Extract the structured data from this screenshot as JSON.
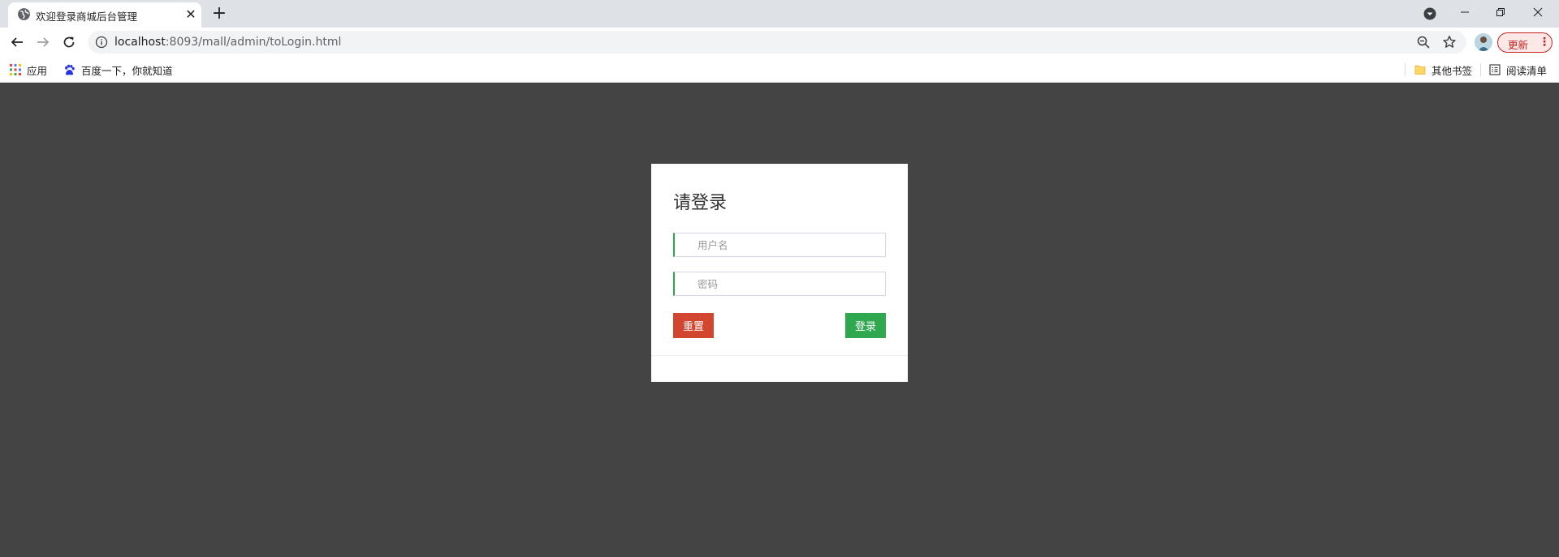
{
  "browser": {
    "tab": {
      "title": "欢迎登录商城后台管理",
      "close_glyph": "✕"
    },
    "new_tab_glyph": "+",
    "url_host": "localhost",
    "url_path": ":8093/mall/admin/toLogin.html",
    "update_label": "更新",
    "update_dots": "⋮",
    "bookmarks": {
      "apps": "应用",
      "baidu": "百度一下，你就知道",
      "other": "其他书签",
      "reading": "阅读清单"
    }
  },
  "login": {
    "title": "请登录",
    "username_placeholder": "用户名",
    "password_placeholder": "密码",
    "reset_label": "重置",
    "submit_label": "登录"
  },
  "colors": {
    "page_background": "#444444",
    "reset_button": "#d2452f",
    "login_button": "#2fa84f",
    "input_accent": "#2ea44f"
  }
}
